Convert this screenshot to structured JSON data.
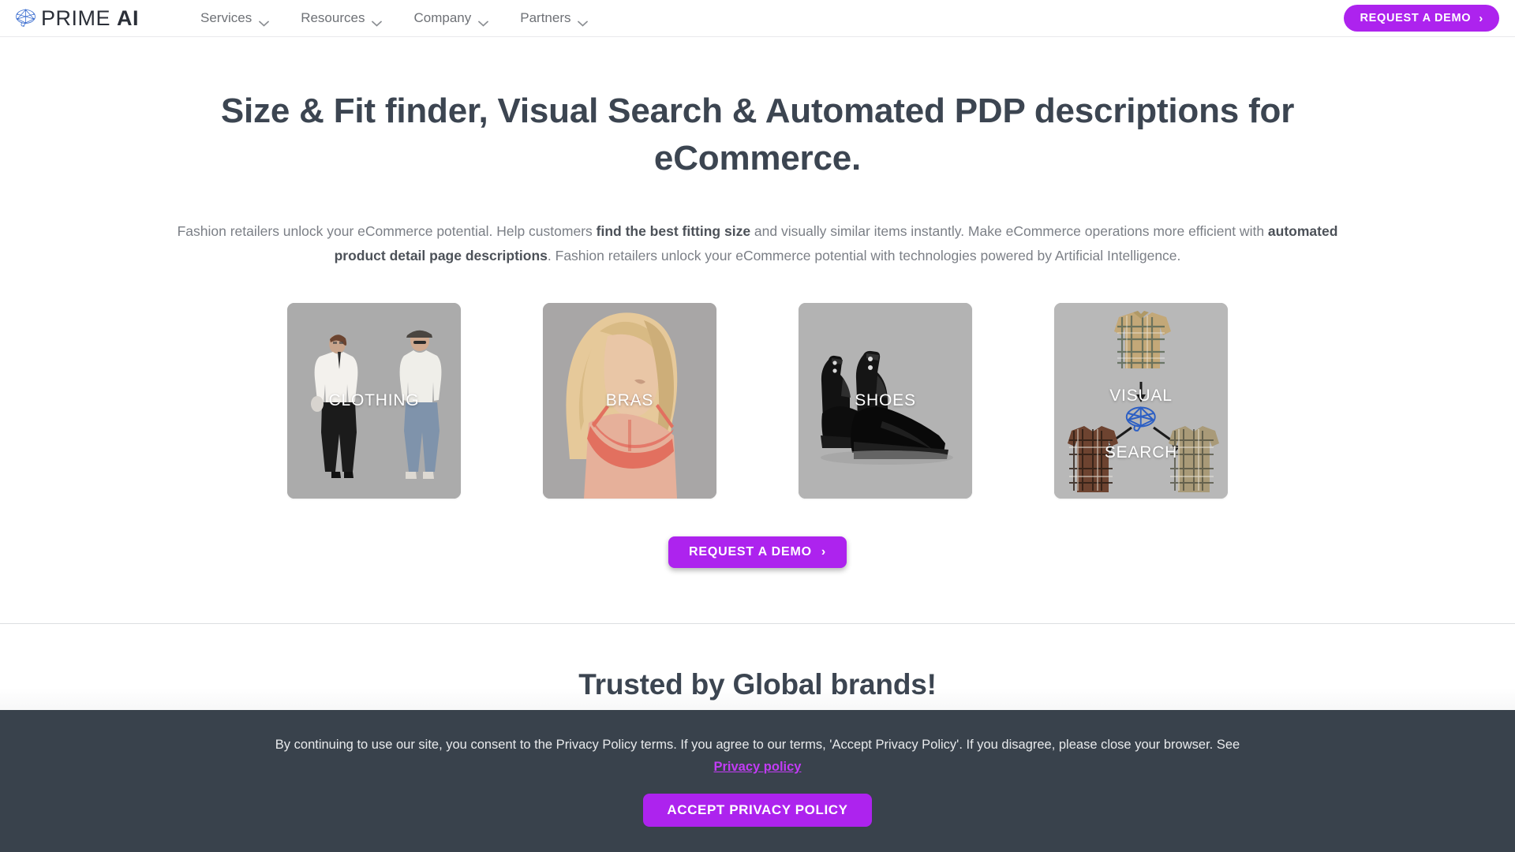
{
  "brand": {
    "logo_text_light": "PRIME ",
    "logo_text_bold": "AI",
    "accent_color": "#ad23ee",
    "heading_color": "#3c4551",
    "banner_bg": "#39424c"
  },
  "header": {
    "nav": [
      {
        "label": "Services",
        "icon": "chevron-down-icon"
      },
      {
        "label": "Resources",
        "icon": "chevron-down-icon"
      },
      {
        "label": "Company",
        "icon": "chevron-down-icon"
      },
      {
        "label": "Partners",
        "icon": "chevron-down-icon"
      }
    ],
    "cta_label": "REQUEST A DEMO",
    "cta_arrow": "›"
  },
  "hero": {
    "headline": "Size & Fit finder, Visual Search & Automated PDP descriptions for eCommerce.",
    "paragraph": {
      "p1": "Fashion retailers unlock your eCommerce potential. Help customers ",
      "b1": "find the best fitting size",
      "p2": " and visually similar items instantly. Make eCommerce operations more efficient with ",
      "b2": "automated product detail page descriptions",
      "p3": ". Fashion retailers unlock your eCommerce potential with technologies powered by Artificial Intelligence."
    },
    "cards": [
      {
        "label": "CLOTHING",
        "name": "card-clothing"
      },
      {
        "label": "BRAS",
        "name": "card-bras"
      },
      {
        "label": "SHOES",
        "name": "card-shoes"
      },
      {
        "label": "VISUAL",
        "label2": "SEARCH",
        "name": "card-visual-search"
      }
    ],
    "cta_label": "REQUEST A DEMO",
    "cta_arrow": "›"
  },
  "trusted": {
    "heading": "Trusted by Global brands!"
  },
  "cookie": {
    "text": "By continuing to use our site, you consent to the Privacy Policy terms. If you agree to our terms, 'Accept Privacy Policy'. If you disagree, please close your browser. See",
    "link_label": "Privacy policy",
    "button_label": "ACCEPT PRIVACY POLICY"
  }
}
